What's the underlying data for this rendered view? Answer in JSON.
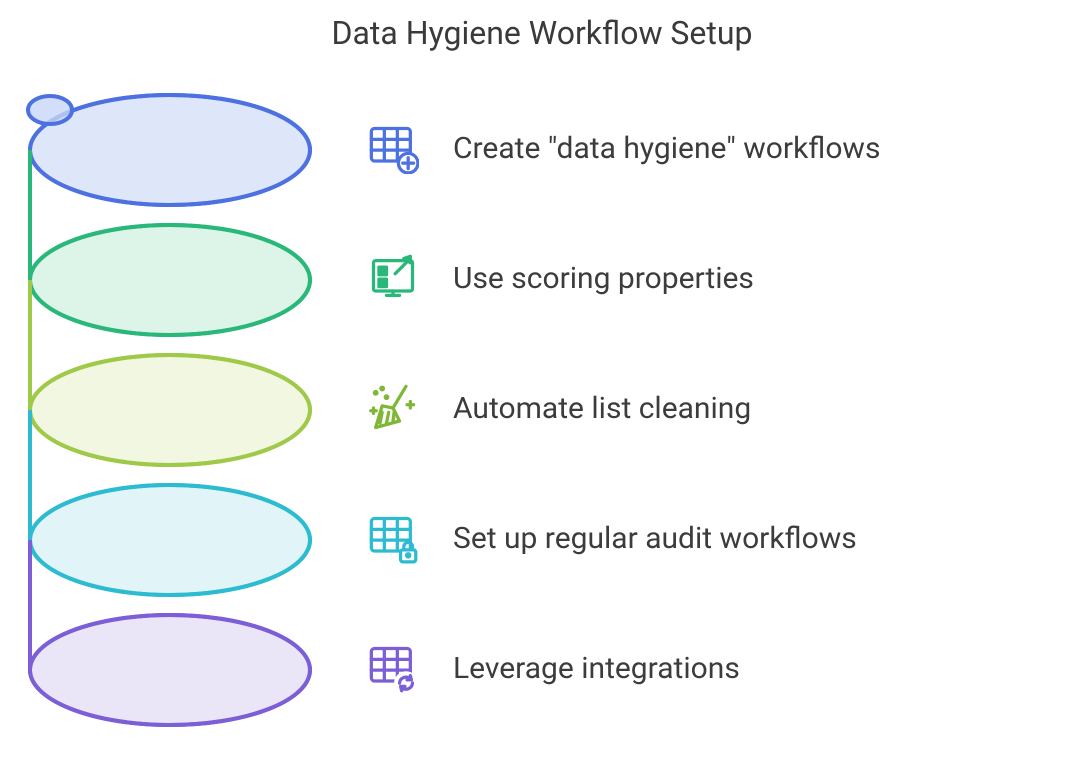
{
  "title": "Data Hygiene Workflow Setup",
  "colors": {
    "blue": "#4d71e0",
    "green": "#2ab87a",
    "olive": "#7fb736",
    "teal": "#2cbbd1",
    "purple": "#7c5ed6"
  },
  "items": [
    {
      "label": "Create \"data hygiene\" workflows",
      "icon": "table-add-icon",
      "color": "blue"
    },
    {
      "label": "Use scoring properties",
      "icon": "scorecard-icon",
      "color": "green"
    },
    {
      "label": "Automate list cleaning",
      "icon": "broom-icon",
      "color": "olive"
    },
    {
      "label": "Set up regular audit workflows",
      "icon": "table-lock-icon",
      "color": "teal"
    },
    {
      "label": "Leverage integrations",
      "icon": "table-refresh-icon",
      "color": "purple"
    }
  ]
}
